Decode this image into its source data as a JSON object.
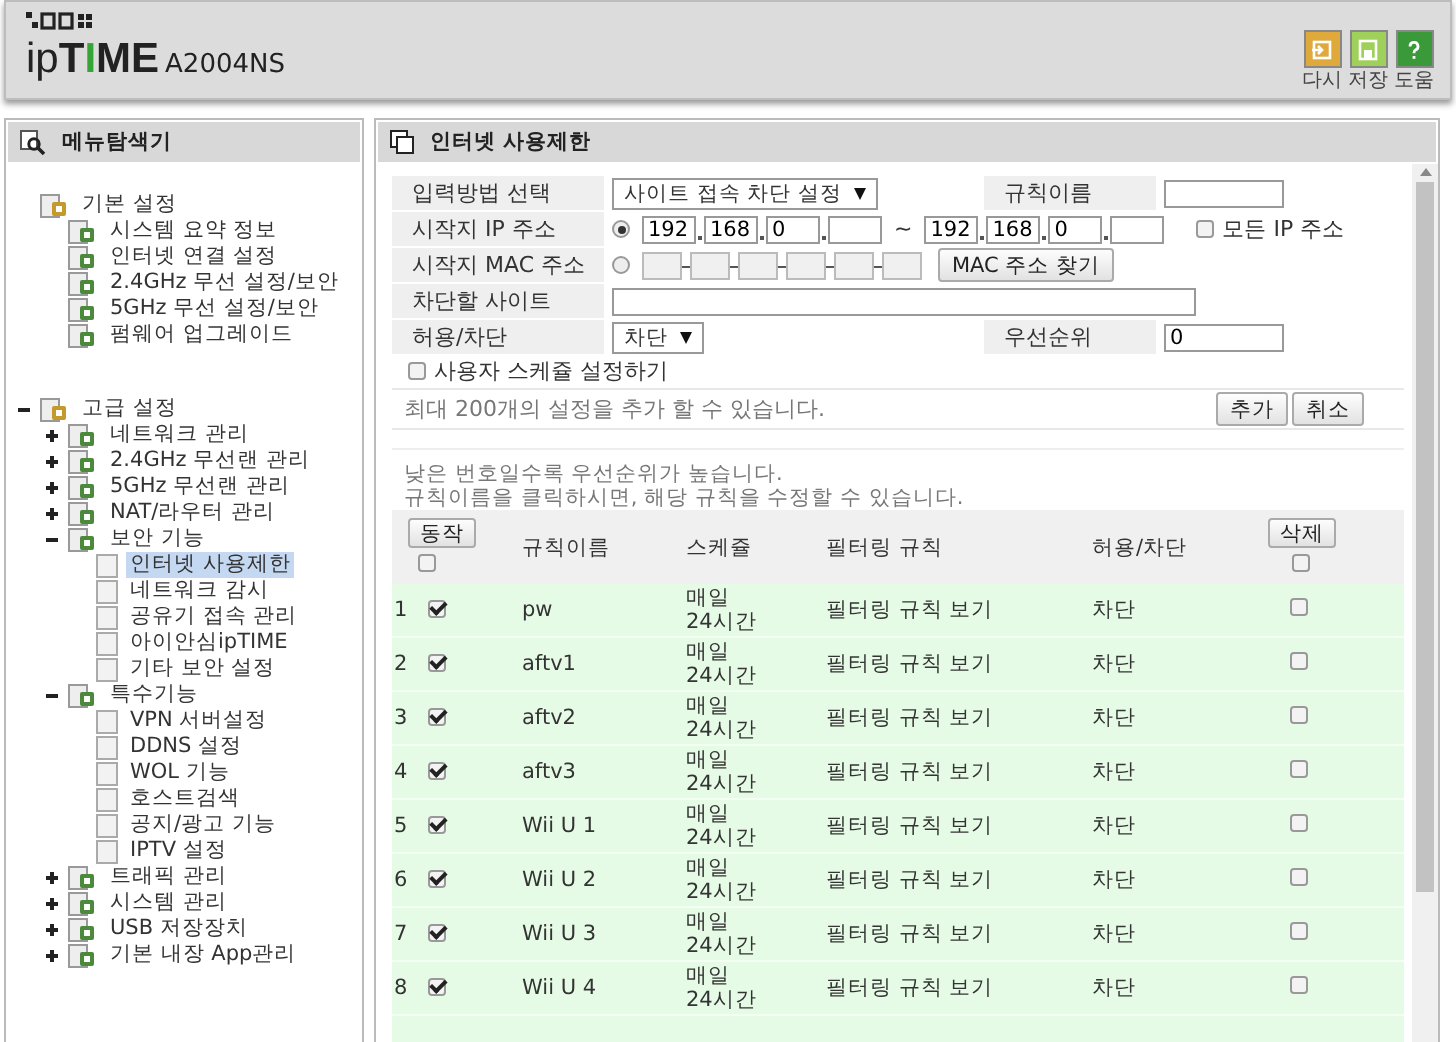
{
  "header": {
    "logo_prefix": "ip",
    "logo_brand": "TIME",
    "model": "A2004NS",
    "actions": [
      {
        "kind": "undo",
        "label": "다시",
        "color": "#e0a93c"
      },
      {
        "kind": "save",
        "label": "저장",
        "color": "#9fd05a"
      },
      {
        "kind": "help",
        "label": "도움",
        "color": "#3a9a3a"
      }
    ]
  },
  "sidebar": {
    "title": "메뉴탐색기",
    "tree": [
      {
        "label": "기본 설정",
        "selected": false,
        "children": [
          {
            "label": "시스템 요약 정보",
            "selected": false
          },
          {
            "label": "인터넷 연결 설정",
            "selected": false
          },
          {
            "label": "2.4GHz 무선 설정/보안",
            "selected": false
          },
          {
            "label": "5GHz 무선 설정/보안",
            "selected": false
          },
          {
            "label": "펌웨어 업그레이드",
            "selected": false
          }
        ]
      },
      {
        "label": "고급 설정",
        "selected": false,
        "expanded": true,
        "gap": true,
        "children": [
          {
            "label": "네트워크 관리",
            "selected": false,
            "expanded": false
          },
          {
            "label": "2.4GHz 무선랜 관리",
            "selected": false,
            "expanded": false
          },
          {
            "label": "5GHz 무선랜 관리",
            "selected": false,
            "expanded": false
          },
          {
            "label": "NAT/라우터 관리",
            "selected": false,
            "expanded": false
          },
          {
            "label": "보안 기능",
            "selected": false,
            "expanded": true,
            "children": [
              {
                "label": "인터넷 사용제한",
                "selected": true
              },
              {
                "label": "네트워크 감시",
                "selected": false
              },
              {
                "label": "공유기 접속 관리",
                "selected": false
              },
              {
                "label": "아이안심ipTIME",
                "selected": false
              },
              {
                "label": "기타 보안 설정",
                "selected": false
              }
            ]
          },
          {
            "label": "특수기능",
            "selected": false,
            "expanded": true,
            "children": [
              {
                "label": "VPN 서버설정",
                "selected": false
              },
              {
                "label": "DDNS 설정",
                "selected": false
              },
              {
                "label": "WOL 기능",
                "selected": false
              },
              {
                "label": "호스트검색",
                "selected": false
              },
              {
                "label": "공지/광고 기능",
                "selected": false
              },
              {
                "label": "IPTV 설정",
                "selected": false
              }
            ]
          },
          {
            "label": "트래픽 관리",
            "selected": false,
            "expanded": false
          },
          {
            "label": "시스템 관리",
            "selected": false,
            "expanded": false
          },
          {
            "label": "USB 저장장치",
            "selected": false,
            "expanded": false
          },
          {
            "label": "기본 내장 App관리",
            "selected": false,
            "expanded": false
          }
        ]
      }
    ]
  },
  "main": {
    "title": "인터넷 사용제한",
    "form": {
      "method": {
        "label": "입력방법 선택",
        "value": "사이트 접속 차단 설정"
      },
      "rule_name": {
        "label": "규칙이름"
      },
      "source_ip": {
        "label": "시작지 IP 주소",
        "selected": true,
        "start": [
          "192",
          "168",
          "0"
        ],
        "range_sep": "~",
        "end": [
          "192",
          "168",
          "0"
        ]
      },
      "all_ip": {
        "label": "모든 IP 주소",
        "checked": false
      },
      "source_mac": {
        "label": "시작지 MAC 주소",
        "selected": false,
        "button": "MAC 주소 찾기"
      },
      "block_site": {
        "label": "차단할 사이트"
      },
      "action": {
        "label": "허용/차단",
        "value": "차단"
      },
      "priority": {
        "label": "우선순위",
        "value": "0"
      },
      "schedule": {
        "label": "사용자 스케쥴 설정하기",
        "checked": false
      },
      "note": "최대 200개의 설정을 추가 할 수 있습니다.",
      "buttons": [
        "추가",
        "취소"
      ]
    },
    "hints": [
      "낮은 번호일수록 우선순위가 높습니다.",
      "규칙이름을 클릭하시면, 해당 규칙을 수정할 수 있습니다."
    ],
    "table": {
      "action_button": "동작",
      "select_all_checked": false,
      "columns": [
        "규칙이름",
        "스케쥴",
        "필터링 규칙",
        "허용/차단"
      ],
      "delete_button": "삭제",
      "delete_all_checked": false,
      "rows": [
        {
          "number": "1",
          "checked": true,
          "name": "pw",
          "schedule": "매일 24시간",
          "filter": "필터링 규칙 보기",
          "mode": "차단",
          "delete_checked": false
        },
        {
          "number": "2",
          "checked": true,
          "name": "aftv1",
          "schedule": "매일 24시간",
          "filter": "필터링 규칙 보기",
          "mode": "차단",
          "delete_checked": false
        },
        {
          "number": "3",
          "checked": true,
          "name": "aftv2",
          "schedule": "매일 24시간",
          "filter": "필터링 규칙 보기",
          "mode": "차단",
          "delete_checked": false
        },
        {
          "number": "4",
          "checked": true,
          "name": "aftv3",
          "schedule": "매일 24시간",
          "filter": "필터링 규칙 보기",
          "mode": "차단",
          "delete_checked": false
        },
        {
          "number": "5",
          "checked": true,
          "name": "Wii U 1",
          "schedule": "매일 24시간",
          "filter": "필터링 규칙 보기",
          "mode": "차단",
          "delete_checked": false
        },
        {
          "number": "6",
          "checked": true,
          "name": "Wii U 2",
          "schedule": "매일 24시간",
          "filter": "필터링 규칙 보기",
          "mode": "차단",
          "delete_checked": false
        },
        {
          "number": "7",
          "checked": true,
          "name": "Wii U 3",
          "schedule": "매일 24시간",
          "filter": "필터링 규칙 보기",
          "mode": "차단",
          "delete_checked": false
        },
        {
          "number": "8",
          "checked": true,
          "name": "Wii U 4",
          "schedule": "매일 24시간",
          "filter": "필터링 규칙 보기",
          "mode": "차단",
          "delete_checked": false
        }
      ]
    }
  }
}
